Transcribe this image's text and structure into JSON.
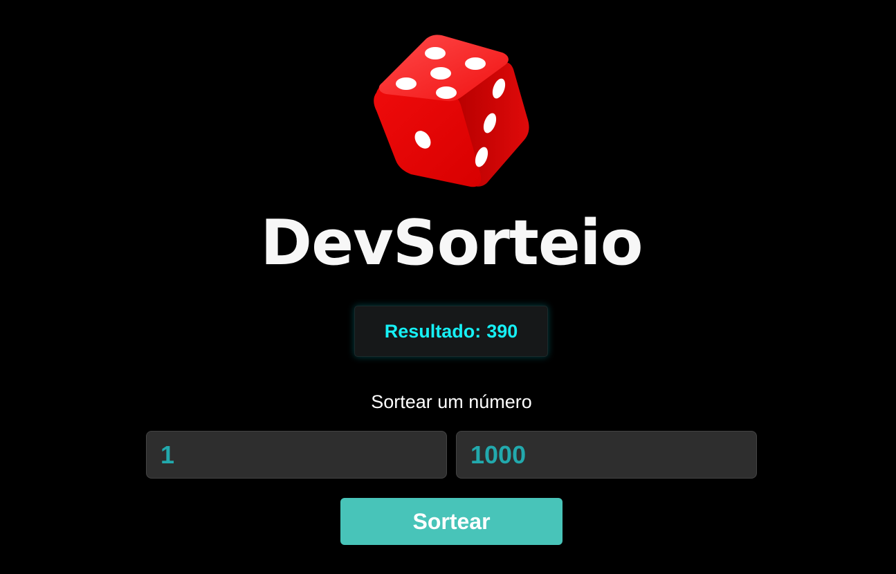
{
  "app": {
    "title": "DevSorteio",
    "logo_icon": "red-dice-icon"
  },
  "result": {
    "label": "Resultado:",
    "value": "390"
  },
  "form": {
    "subtitle": "Sortear um número",
    "min_value": "1",
    "max_value": "1000",
    "button_label": "Sortear"
  },
  "colors": {
    "background": "#000000",
    "accent_cyan": "#16f0f5",
    "button_teal": "#48c4b9",
    "input_text": "#22a9ad",
    "dice_red": "#e10000"
  }
}
